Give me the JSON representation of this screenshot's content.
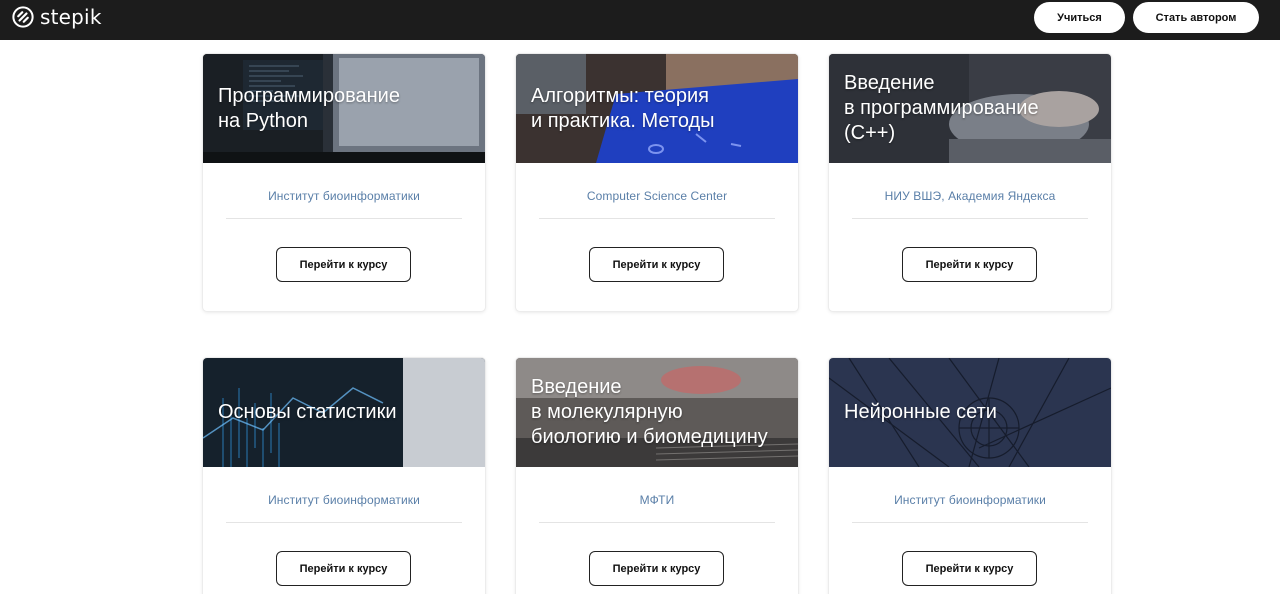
{
  "header": {
    "logo_text": "stepik",
    "logo_icon": "stepik-logo-icon",
    "learn_label": "Учиться",
    "author_label": "Стать автором"
  },
  "colors": {
    "topbar": "#1c1c1c",
    "org_link": "#5a7fa8"
  },
  "courses": [
    {
      "title_lines": [
        "Программирование",
        "на Python"
      ],
      "org": "Институт биоинформатики",
      "button": "Перейти к курсу"
    },
    {
      "title_lines": [
        "Алгоритмы: теория",
        "и практика. Методы"
      ],
      "org": "Computer Science Center",
      "button": "Перейти к курсу"
    },
    {
      "title_lines": [
        "Введение",
        "в программирование",
        "(C++)"
      ],
      "org": "НИУ ВШЭ, Академия Яндекса",
      "button": "Перейти к курсу"
    },
    {
      "title_lines": [
        "Основы статистики"
      ],
      "org": "Институт биоинформатики",
      "button": "Перейти к курсу"
    },
    {
      "title_lines": [
        "Введение",
        "в молекулярную",
        "биологию и биомедицину"
      ],
      "org": "МФТИ",
      "button": "Перейти к курсу"
    },
    {
      "title_lines": [
        "Нейронные сети"
      ],
      "org": "Институт биоинформатики",
      "button": "Перейти к курсу"
    }
  ]
}
